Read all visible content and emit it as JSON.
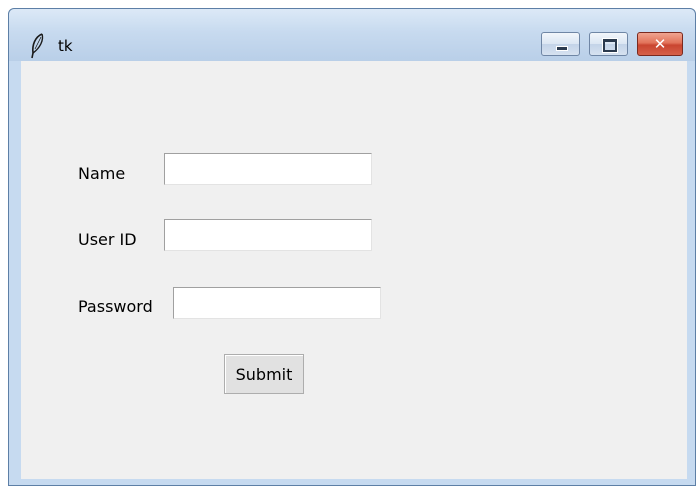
{
  "window": {
    "title": "tk",
    "controls": {
      "minimize_icon": "minimize-icon",
      "maximize_icon": "maximize-icon",
      "close_glyph": "✕"
    },
    "colors": {
      "titlebar": "#c7daef",
      "client_background": "#f0f0f0",
      "close_button": "#c94530"
    }
  },
  "form": {
    "name_label": "Name",
    "name_value": "",
    "userid_label": "User ID",
    "userid_value": "",
    "password_label": "Password",
    "password_value": "",
    "submit_label": "Submit"
  }
}
